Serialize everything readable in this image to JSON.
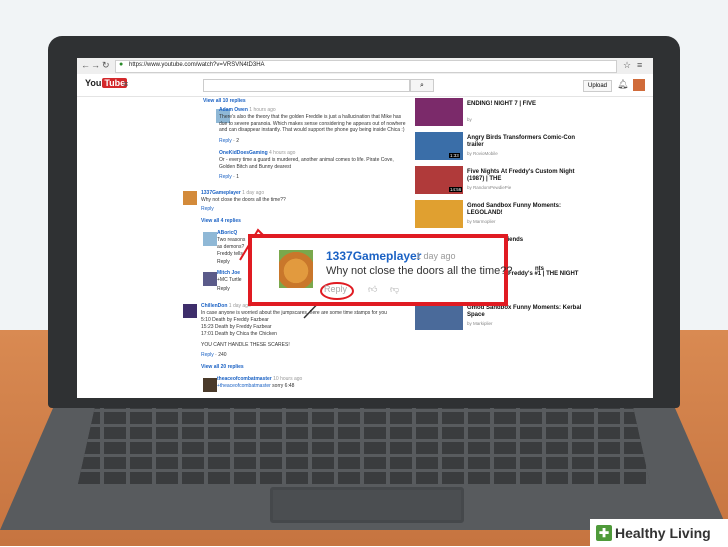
{
  "browser": {
    "url": "https://www.youtube.com/watch?v=VRSVN4tD3HA"
  },
  "header": {
    "logo_you": "You",
    "logo_tube": "Tube",
    "upload_label": "Upload"
  },
  "comments": {
    "view_replies_top": "View all 10 replies",
    "reply_1": {
      "author": "Adam Owen",
      "age": "1 hours ago",
      "text": "There's also the theory that the golden Freddie is just a hallucination that Mike has due to severe paranoia. Which makes sense considering he appears out of nowhere and can disappear instantly. That would support the phone guy being inside Chica :)",
      "reply": "Reply",
      "likes": "2"
    },
    "reply_2": {
      "author": "OneKidDoesGaming",
      "age": "4 hours ago",
      "text": "Or - every time a guard is murdered, another animal comes to life. Pirate Cove, Golden Bitch and Bunny dearest",
      "reply": "Reply",
      "likes": "1"
    },
    "main": {
      "author": "1337Gameplayer",
      "age": "1 day ago",
      "text": "Why not close the doors all the time??",
      "reply": "Reply"
    },
    "view_replies_mid": "View all 4 replies",
    "reply_3": {
      "author": "ABoricQ",
      "text_1": "Two reasons",
      "text_2": "as demons?",
      "text_3": "Freddy tells",
      "reply": "Reply"
    },
    "reply_4": {
      "author": "Mitch Joe",
      "text": "+MC Turtle",
      "reply": "Reply"
    },
    "chillen": {
      "author": "ChillenDon",
      "age": "1 day ago",
      "text": "In case anyone is worried about the jumpscares, here are some time stamps for you",
      "ts1": "5:10 Death by Freddy Fazbear",
      "ts2": "15:23 Death by Freddy Fazbear",
      "ts3": "17:01 Death by Chica the Chicken",
      "caps": "YOU CANT HANDLE THESE SCARES!",
      "reply": "Reply",
      "likes": "240"
    },
    "view_replies_bottom": "View all 20 replies",
    "bottom": {
      "author": "theaceofcombatmaster",
      "age": "10 hours ago",
      "text": "+theaceofcombatmaster",
      "text_2": "sorry 6:48"
    }
  },
  "sidebar": {
    "items": [
      {
        "title": "ENDING! NIGHT 7 | FIVE",
        "by": "by",
        "dur": ""
      },
      {
        "title": "Angry Birds Transformers Comic-Con trailer",
        "by": "by RovioMobile",
        "dur": "1:33"
      },
      {
        "title": "Five Nights At Freddy's Custom Night (1987) | THE",
        "by": "by RandomPewdiePie",
        "dur": "14:56"
      },
      {
        "title": "Gmod Sandbox Funny Moments: LEGOLAND!",
        "by": "by Marmoplier",
        "dur": ""
      },
      {
        "title": "Mount Your Friends",
        "by": "",
        "dur": ""
      },
      {
        "title": "Five Nights at Freddy's #1 | THE NIGHT SHIFT",
        "by": "by jacksepticeye",
        "dur": ""
      },
      {
        "title": "Gmod Sandbox Funny Moments: Kerbal Space",
        "by": "by Markiplier",
        "dur": ""
      }
    ],
    "partial_text": "nts"
  },
  "zoom": {
    "author": "1337Gameplayer",
    "age": "1 day ago",
    "text": "Why not close the doors all the time??",
    "reply": "Reply"
  },
  "watermark": {
    "text": "Healthy Living",
    "icon": "heart-plus-icon"
  },
  "colors": {
    "link": "#1b62c4",
    "highlight": "#e01b22",
    "brand": "#4f9a3a"
  }
}
